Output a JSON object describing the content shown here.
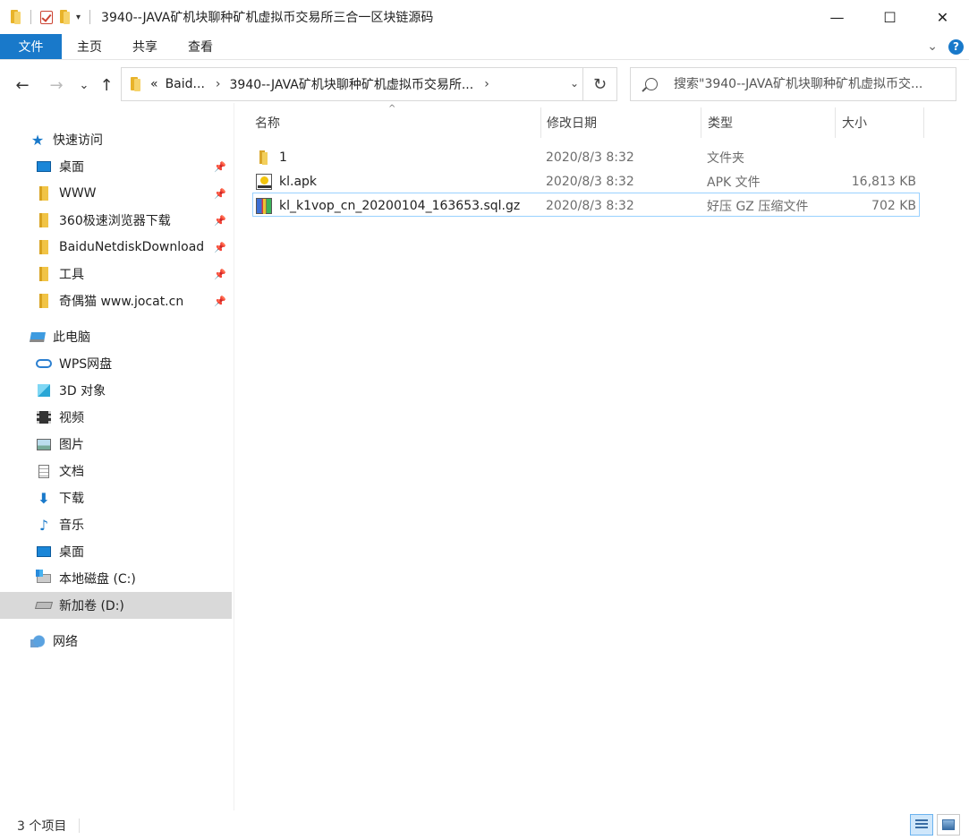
{
  "window": {
    "title": "3940--JAVA矿机块聊种矿机虚拟币交易所三合一区块链源码",
    "minimize": "—",
    "maximize": "☐",
    "close": "✕"
  },
  "ribbon": {
    "tabs": [
      "文件",
      "主页",
      "共享",
      "查看"
    ],
    "help": "?"
  },
  "nav": {
    "back": "←",
    "forward": "→",
    "recent": "⌄",
    "up": "↑",
    "address_prefix": "«",
    "crumbs": [
      "Baid...",
      "3940--JAVA矿机块聊种矿机虚拟币交易所..."
    ],
    "search_placeholder": "搜索\"3940--JAVA矿机块聊种矿机虚拟币交...",
    "refresh": "↻"
  },
  "navpane": {
    "quick_access": "快速访问",
    "quick_items": [
      "桌面",
      "WWW",
      "360极速浏览器下载",
      "BaiduNetdiskDownload",
      "工具",
      "奇偶猫 www.jocat.cn"
    ],
    "this_pc": "此电脑",
    "pc_items": [
      "WPS网盘",
      "3D 对象",
      "视频",
      "图片",
      "文档",
      "下载",
      "音乐",
      "桌面",
      "本地磁盘 (C:)",
      "新加卷 (D:)"
    ],
    "network": "网络"
  },
  "columns": {
    "name": "名称",
    "modified": "修改日期",
    "type": "类型",
    "size": "大小"
  },
  "files": [
    {
      "name": "1",
      "modified": "2020/8/3 8:32",
      "type": "文件夹",
      "size": "",
      "icon": "folder-icon"
    },
    {
      "name": "kl.apk",
      "modified": "2020/8/3 8:32",
      "type": "APK 文件",
      "size": "16,813 KB",
      "icon": "apk-file-icon"
    },
    {
      "name": "kl_k1vop_cn_20200104_163653.sql.gz",
      "modified": "2020/8/3 8:32",
      "type": "好压 GZ 压缩文件",
      "size": "702 KB",
      "icon": "archive-file-icon"
    }
  ],
  "status": {
    "item_count": "3 个项目"
  }
}
